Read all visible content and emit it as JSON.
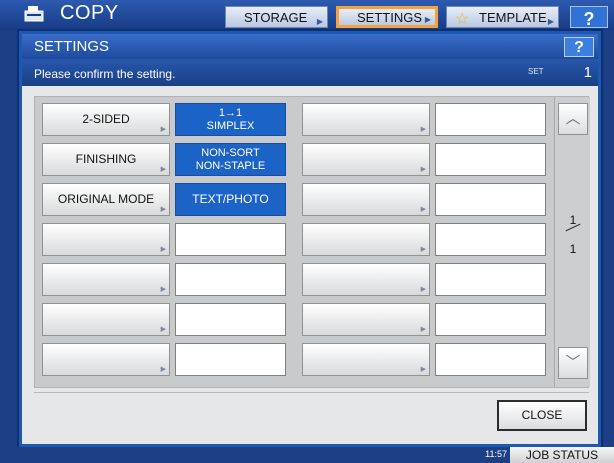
{
  "topbar": {
    "title": "COPY",
    "tabs": [
      {
        "label": "STORAGE"
      },
      {
        "label": "SETTINGS"
      },
      {
        "label": "TEMPLATE"
      }
    ],
    "help_label": "?"
  },
  "dialog": {
    "title": "SETTINGS",
    "help_label": "?",
    "message": "Please confirm the setting.",
    "set_label": "SET",
    "set_count": "1",
    "rows": [
      {
        "label": "2-SIDED",
        "value_line1": "1→1",
        "value_line2": "SIMPLEX"
      },
      {
        "label": "FINISHING",
        "value_line1": "NON-SORT",
        "value_line2": "NON-STAPLE"
      },
      {
        "label": "ORIGINAL MODE",
        "value": "TEXT/PHOTO"
      }
    ],
    "page_current": "1",
    "page_total": "1",
    "close_label": "CLOSE"
  },
  "status": {
    "time": "11:57",
    "job_status_label": "JOB STATUS"
  }
}
